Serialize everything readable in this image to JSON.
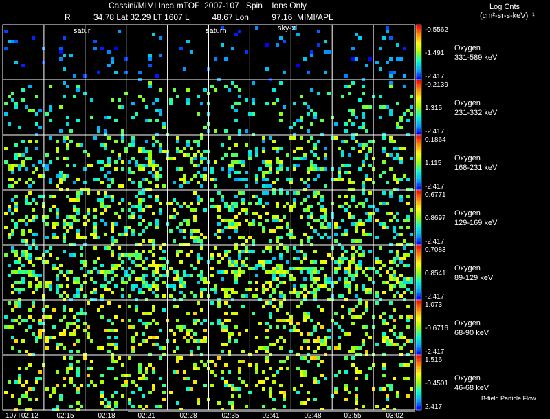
{
  "header": {
    "line1": "Cassini/MIMI Inca mTOF  2007-107   Spin    Ions Only",
    "line2": "R          34.78 Lat 32.29 LT 1607 L          48.67 Lon          97.16  MIMI/APL",
    "cbar_title": "Log Cnts",
    "cbar_units": "(cm²-sr-s-keV)⁻¹",
    "label_saturn_a": "satur",
    "label_saturn_b": "saturn",
    "label_sky": "sky-xl"
  },
  "footer_note": "B-field Particle Flow",
  "chart_data": {
    "type": "heatmap",
    "x_tick_labels": [
      "107T02:12",
      "02:15",
      "02:18",
      "02:21",
      "02:28",
      "02:35",
      "02:41",
      "02:48",
      "02:55",
      "03:02"
    ],
    "colormap": [
      "#0000ff",
      "#00aaff",
      "#00ffcc",
      "#99ff00",
      "#ffff00",
      "#ff8800",
      "#ff0000"
    ],
    "bands": [
      {
        "species": "Oxygen",
        "energy": "331-589 keV",
        "cbar_max": "-0.5562",
        "cbar_mid": "-1.491",
        "cbar_min": "-2.417",
        "density": 0.04,
        "level": [
          0.0,
          0.25
        ]
      },
      {
        "species": "Oxygen",
        "energy": "231-332 keV",
        "cbar_max": "-0.2139",
        "cbar_mid": "1.315",
        "cbar_min": "-2.417",
        "density": 0.1,
        "level": [
          0.15,
          0.5
        ]
      },
      {
        "species": "Oxygen",
        "energy": "168-231 keV",
        "cbar_max": "0.1864",
        "cbar_mid": "1.115",
        "cbar_min": "-2.417",
        "density": 0.22,
        "level": [
          0.15,
          0.65
        ]
      },
      {
        "species": "Oxygen",
        "energy": "129-169 keV",
        "cbar_max": "0.6771",
        "cbar_mid": "0.8697",
        "cbar_min": "-2.417",
        "density": 0.25,
        "level": [
          0.2,
          0.7
        ]
      },
      {
        "species": "Oxygen",
        "energy": "89-129 keV",
        "cbar_max": "0.7083",
        "cbar_mid": "0.8541",
        "cbar_min": "-2.417",
        "density": 0.3,
        "level": [
          0.2,
          0.7
        ]
      },
      {
        "species": "Oxygen",
        "energy": "68-90 keV",
        "cbar_max": "1.073",
        "cbar_mid": "-0.6716",
        "cbar_min": "-2.417",
        "density": 0.2,
        "level": [
          0.3,
          0.75
        ]
      },
      {
        "species": "Oxygen",
        "energy": "46-68 keV",
        "cbar_max": "1.516",
        "cbar_mid": "-0.4501",
        "cbar_min": "2.417",
        "density": 0.15,
        "level": [
          0.3,
          0.75
        ]
      }
    ]
  }
}
